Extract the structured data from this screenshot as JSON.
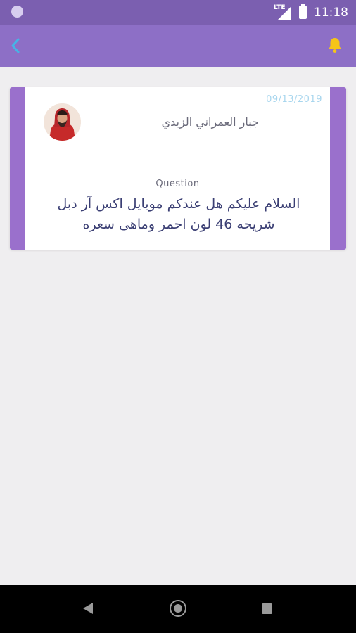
{
  "status_bar": {
    "network": "LTE",
    "time": "11:18"
  },
  "app_bar": {
    "back_icon": "chevron-left-icon",
    "notification_icon": "bell-icon",
    "accent_color": "#f5c518"
  },
  "card": {
    "date": "09/13/2019",
    "author": "جبار العمراني الزيدي",
    "question_label": "Question",
    "question_text": "السلام عليكم هل عندكم موبايل اكس آر دبل شريحه 46 لون احمر وماهى سعره"
  },
  "colors": {
    "status_bar": "#7b5fb0",
    "app_bar": "#8d6fc6",
    "card_stripe": "#9a70cc",
    "date": "#a8d6ee",
    "question_text": "#3b3f74"
  }
}
